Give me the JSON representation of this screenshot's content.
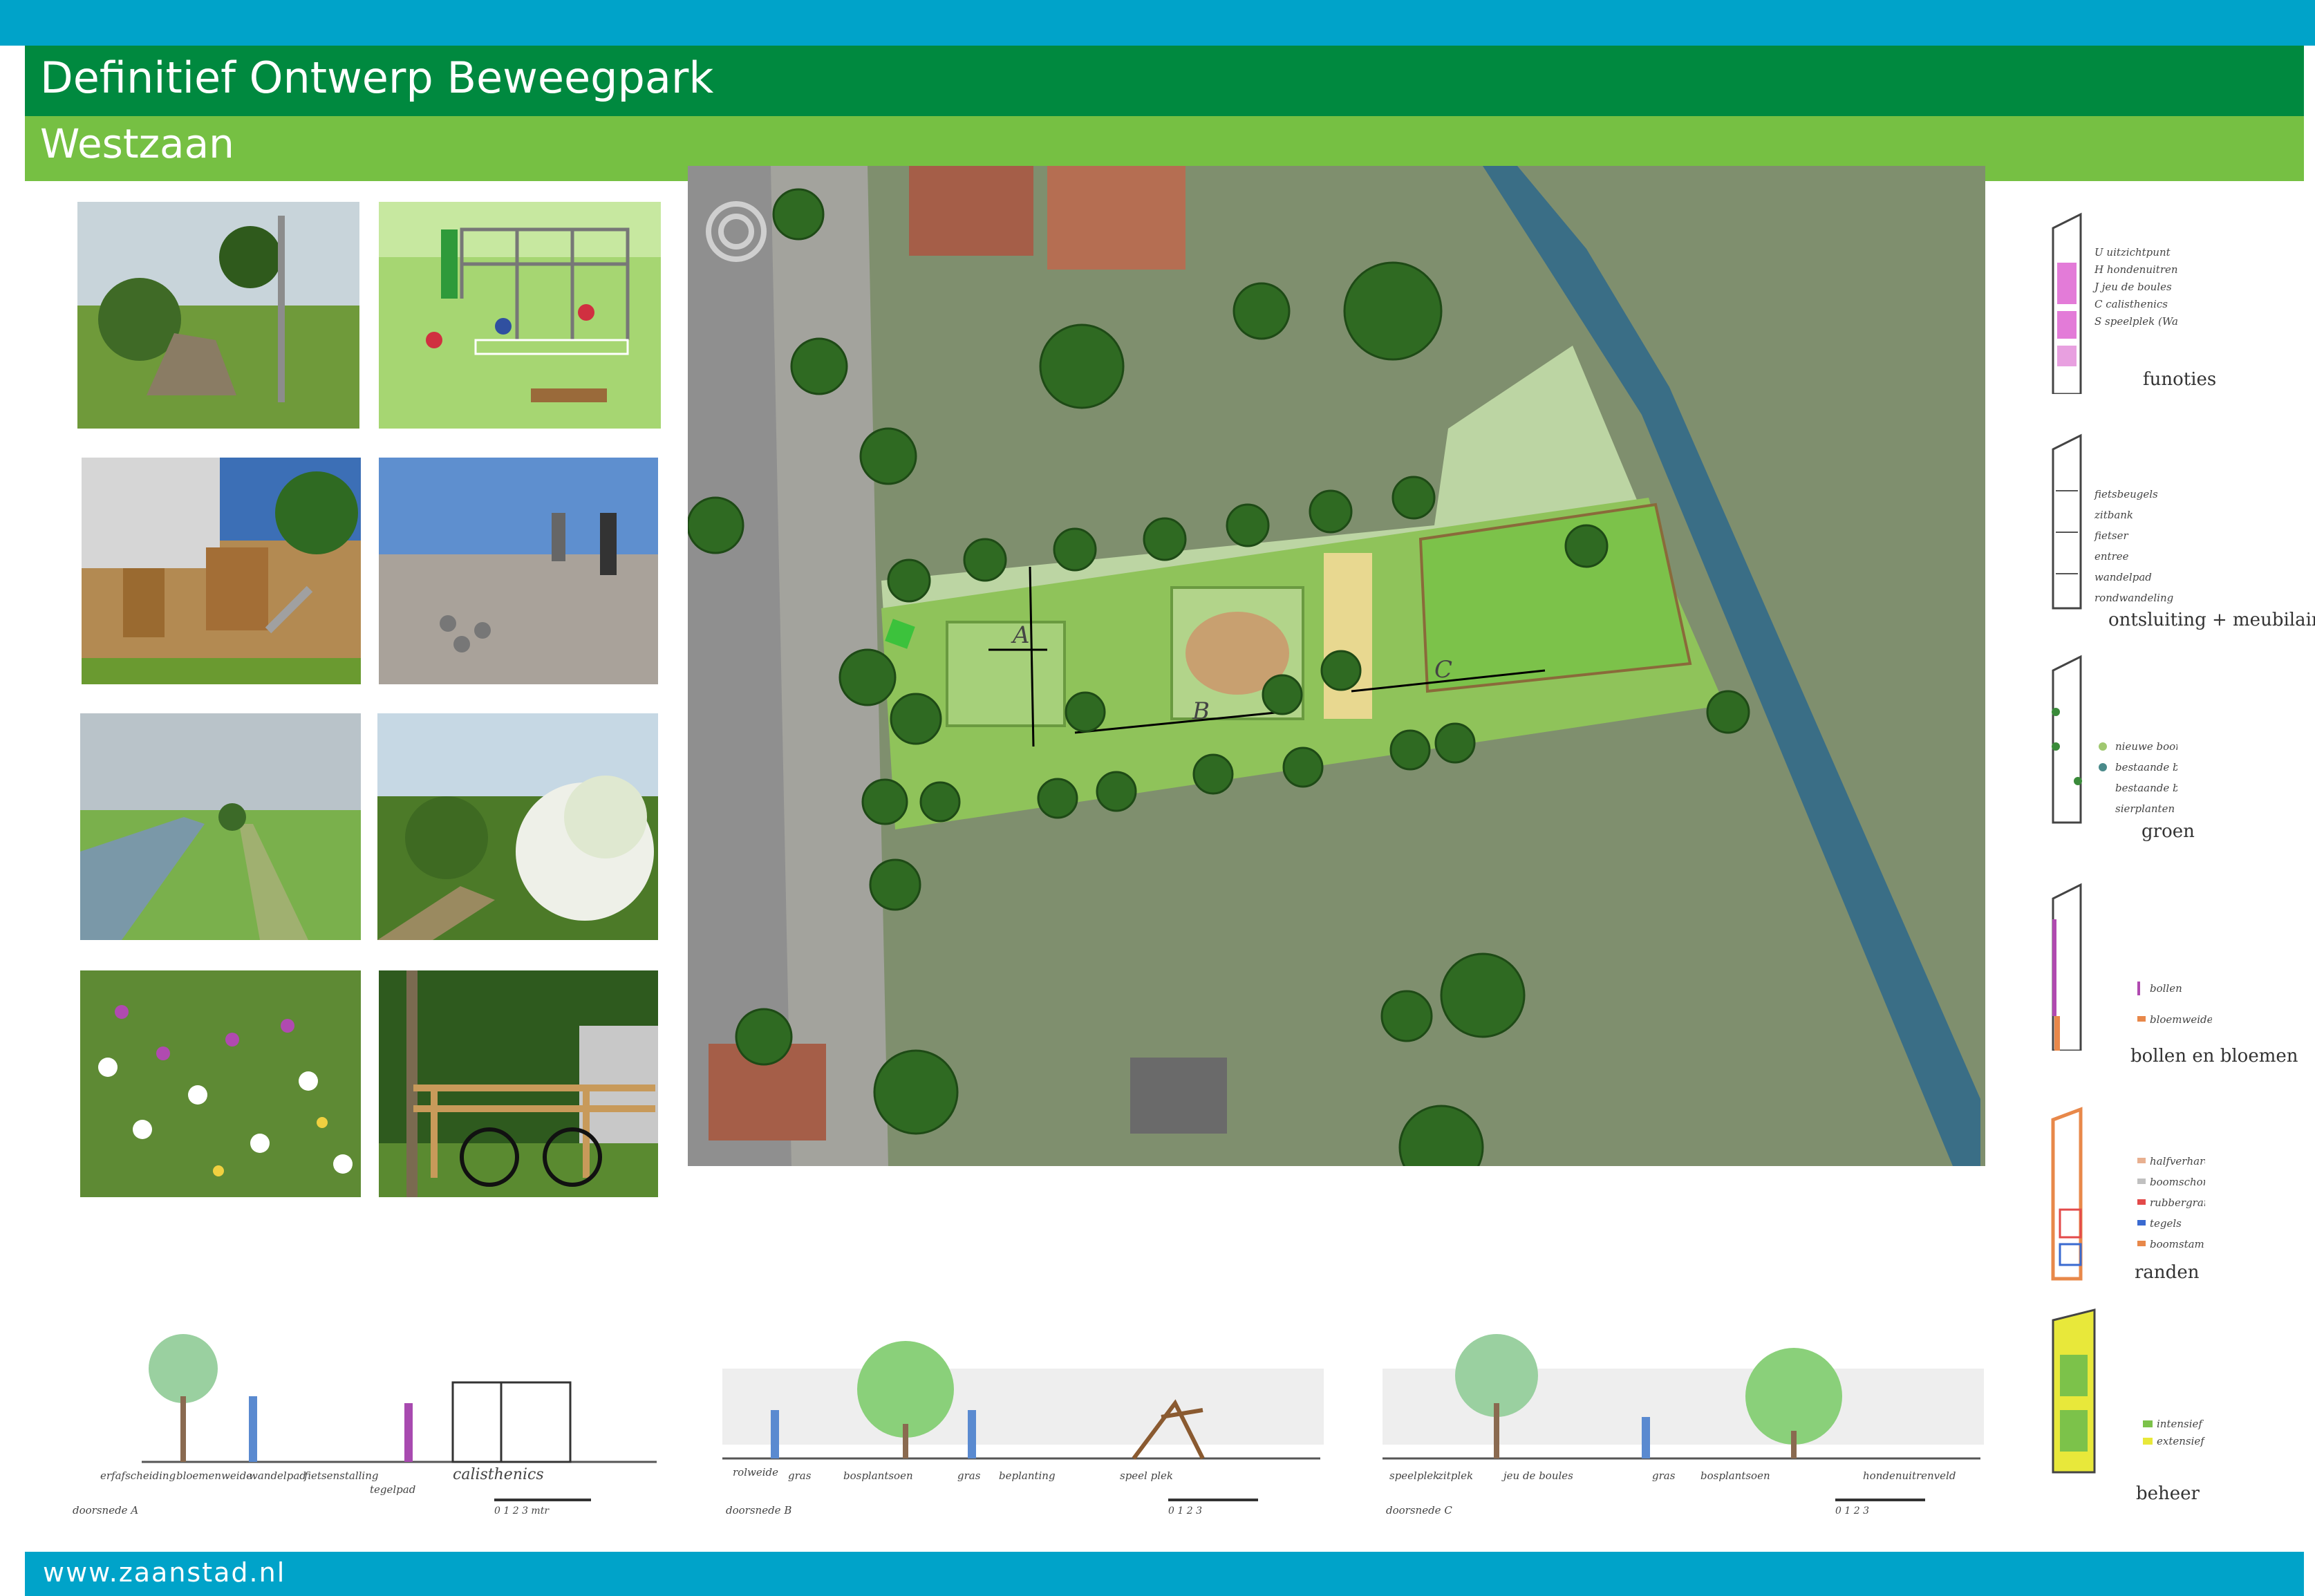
{
  "header": {
    "title": "Definitief Ontwerp Beweegpark",
    "subtitle": "Westzaan"
  },
  "footer": {
    "url": "www.zaanstad.nl"
  },
  "map": {
    "section_labels": [
      "A",
      "B",
      "C"
    ]
  },
  "legends": [
    {
      "caption": "funoties",
      "items": [
        "U uitzichtpunt",
        "H hondenuitrenveld",
        "J jeu de boules",
        "C calisthenics",
        "S speelplek (Wagle)"
      ]
    },
    {
      "caption": "ontsluiting + meubilair",
      "items": [
        "fietsbeugels",
        "zitbank",
        "fietser",
        "entree",
        "wandelpad",
        "rondwandeling"
      ]
    },
    {
      "caption": "groen",
      "items": [
        "nieuwe boom",
        "bestaande boom",
        "bestaande beplanting",
        "sierplanten"
      ]
    },
    {
      "caption": "bollen en bloemen",
      "items": [
        "bollen",
        "bloemweide"
      ]
    },
    {
      "caption": "randen",
      "items": [
        "halfverharding wandelpad",
        "boomschors",
        "rubbergranulaat",
        "tegels",
        "boomstammen"
      ]
    },
    {
      "caption": "beheer",
      "items": [
        "intensief gras",
        "extensief gras"
      ]
    }
  ],
  "sections": [
    {
      "caption": "doorsnede A",
      "labels": [
        "erfafscheiding",
        "bloemenweide",
        "wandelpad",
        "fietsenstalling",
        "tegelpad",
        "calisthenics"
      ],
      "scale": "0 1 2 3 mtr"
    },
    {
      "caption": "doorsnede B",
      "labels": [
        "rolweide",
        "gras",
        "bosplantsoen",
        "gras",
        "beplanting",
        "speel plek"
      ],
      "scale": "0 1 2 3"
    },
    {
      "caption": "doorsnede C",
      "labels": [
        "speelplek",
        "zitplek",
        "jeu de boules",
        "gras",
        "bosplantsoen",
        "hondenuitrenveld"
      ],
      "scale": "0 1 2 3"
    }
  ],
  "colors": {
    "top_band": "#00a3c9",
    "title_band": "#00893f",
    "subtitle_band": "#76c043",
    "footer_band": "#00a3c9"
  }
}
